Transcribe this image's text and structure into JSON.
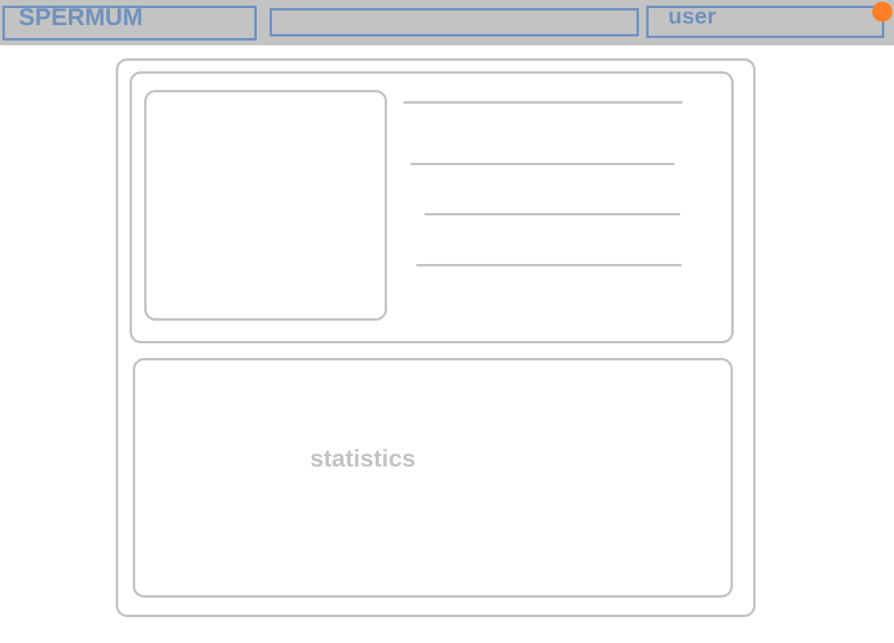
{
  "header": {
    "logo_text": "SPERMUM",
    "search": {
      "value": "",
      "placeholder": ""
    },
    "user_label": "user",
    "notification_icon": "notification-dot"
  },
  "profile": {
    "avatar_icon": "avatar-placeholder",
    "info_lines": [
      "",
      "",
      "",
      ""
    ]
  },
  "statistics": {
    "label": "statistics"
  },
  "colors": {
    "topbar_bg": "#c3c3c3",
    "accent_blue": "#7092be",
    "frame_gray": "#c3c3c3",
    "notification": "#ff7f27"
  }
}
